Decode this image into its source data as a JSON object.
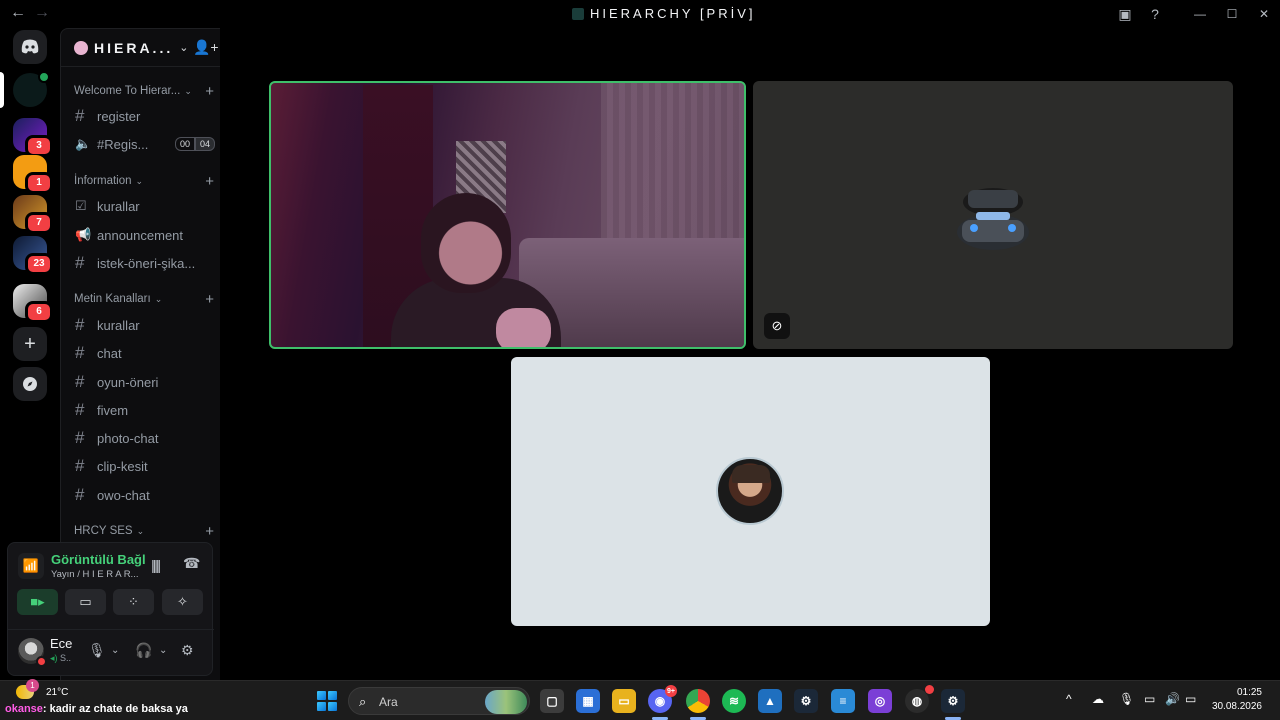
{
  "window": {
    "title": "HIERARCHY [PRİV]",
    "back_icon": "←",
    "forward_icon": "→"
  },
  "server_rail": {
    "badges": [
      "3",
      "1",
      "7",
      "23",
      "6"
    ],
    "add_icon": "+"
  },
  "server": {
    "name": "HIERA...",
    "categories": [
      {
        "name": "Welcome To Hierar..."
      },
      {
        "name": "İnformation"
      },
      {
        "name": "Metin Kanalları"
      },
      {
        "name": "HRCY SES"
      }
    ],
    "channels": [
      {
        "name": "register",
        "type": "text"
      },
      {
        "name": "#Regis...",
        "type": "voice",
        "count_a": "00",
        "count_b": "04"
      },
      {
        "name": "kurallar",
        "type": "rules"
      },
      {
        "name": "announcement",
        "type": "announcement"
      },
      {
        "name": "istek-öneri-şika...",
        "type": "text"
      },
      {
        "name": "kurallar",
        "type": "text"
      },
      {
        "name": "chat",
        "type": "text"
      },
      {
        "name": "oyun-öneri",
        "type": "text"
      },
      {
        "name": "fivem",
        "type": "text"
      },
      {
        "name": "photo-chat",
        "type": "text"
      },
      {
        "name": "clip-kesit",
        "type": "text"
      },
      {
        "name": "owo-chat",
        "type": "text"
      }
    ]
  },
  "voice_panel": {
    "status": "Görüntülü Bağl",
    "sub": "Yayın / H I E R A R..."
  },
  "user": {
    "name": "Ece",
    "status": "S.."
  },
  "taskbar": {
    "weather_temp": "21°C",
    "weather_badge": "1",
    "chat_nick": "okanse",
    "chat_text": ": kadir az chate de baksa ya",
    "search_placeholder": "Ara",
    "discord_badge": "9+",
    "time": "01:25",
    "date": "30.08.2026"
  },
  "colors": {
    "accent_green": "#45d17a",
    "badge_red": "#f23f43",
    "speaking_border": "#3fbf6a"
  }
}
